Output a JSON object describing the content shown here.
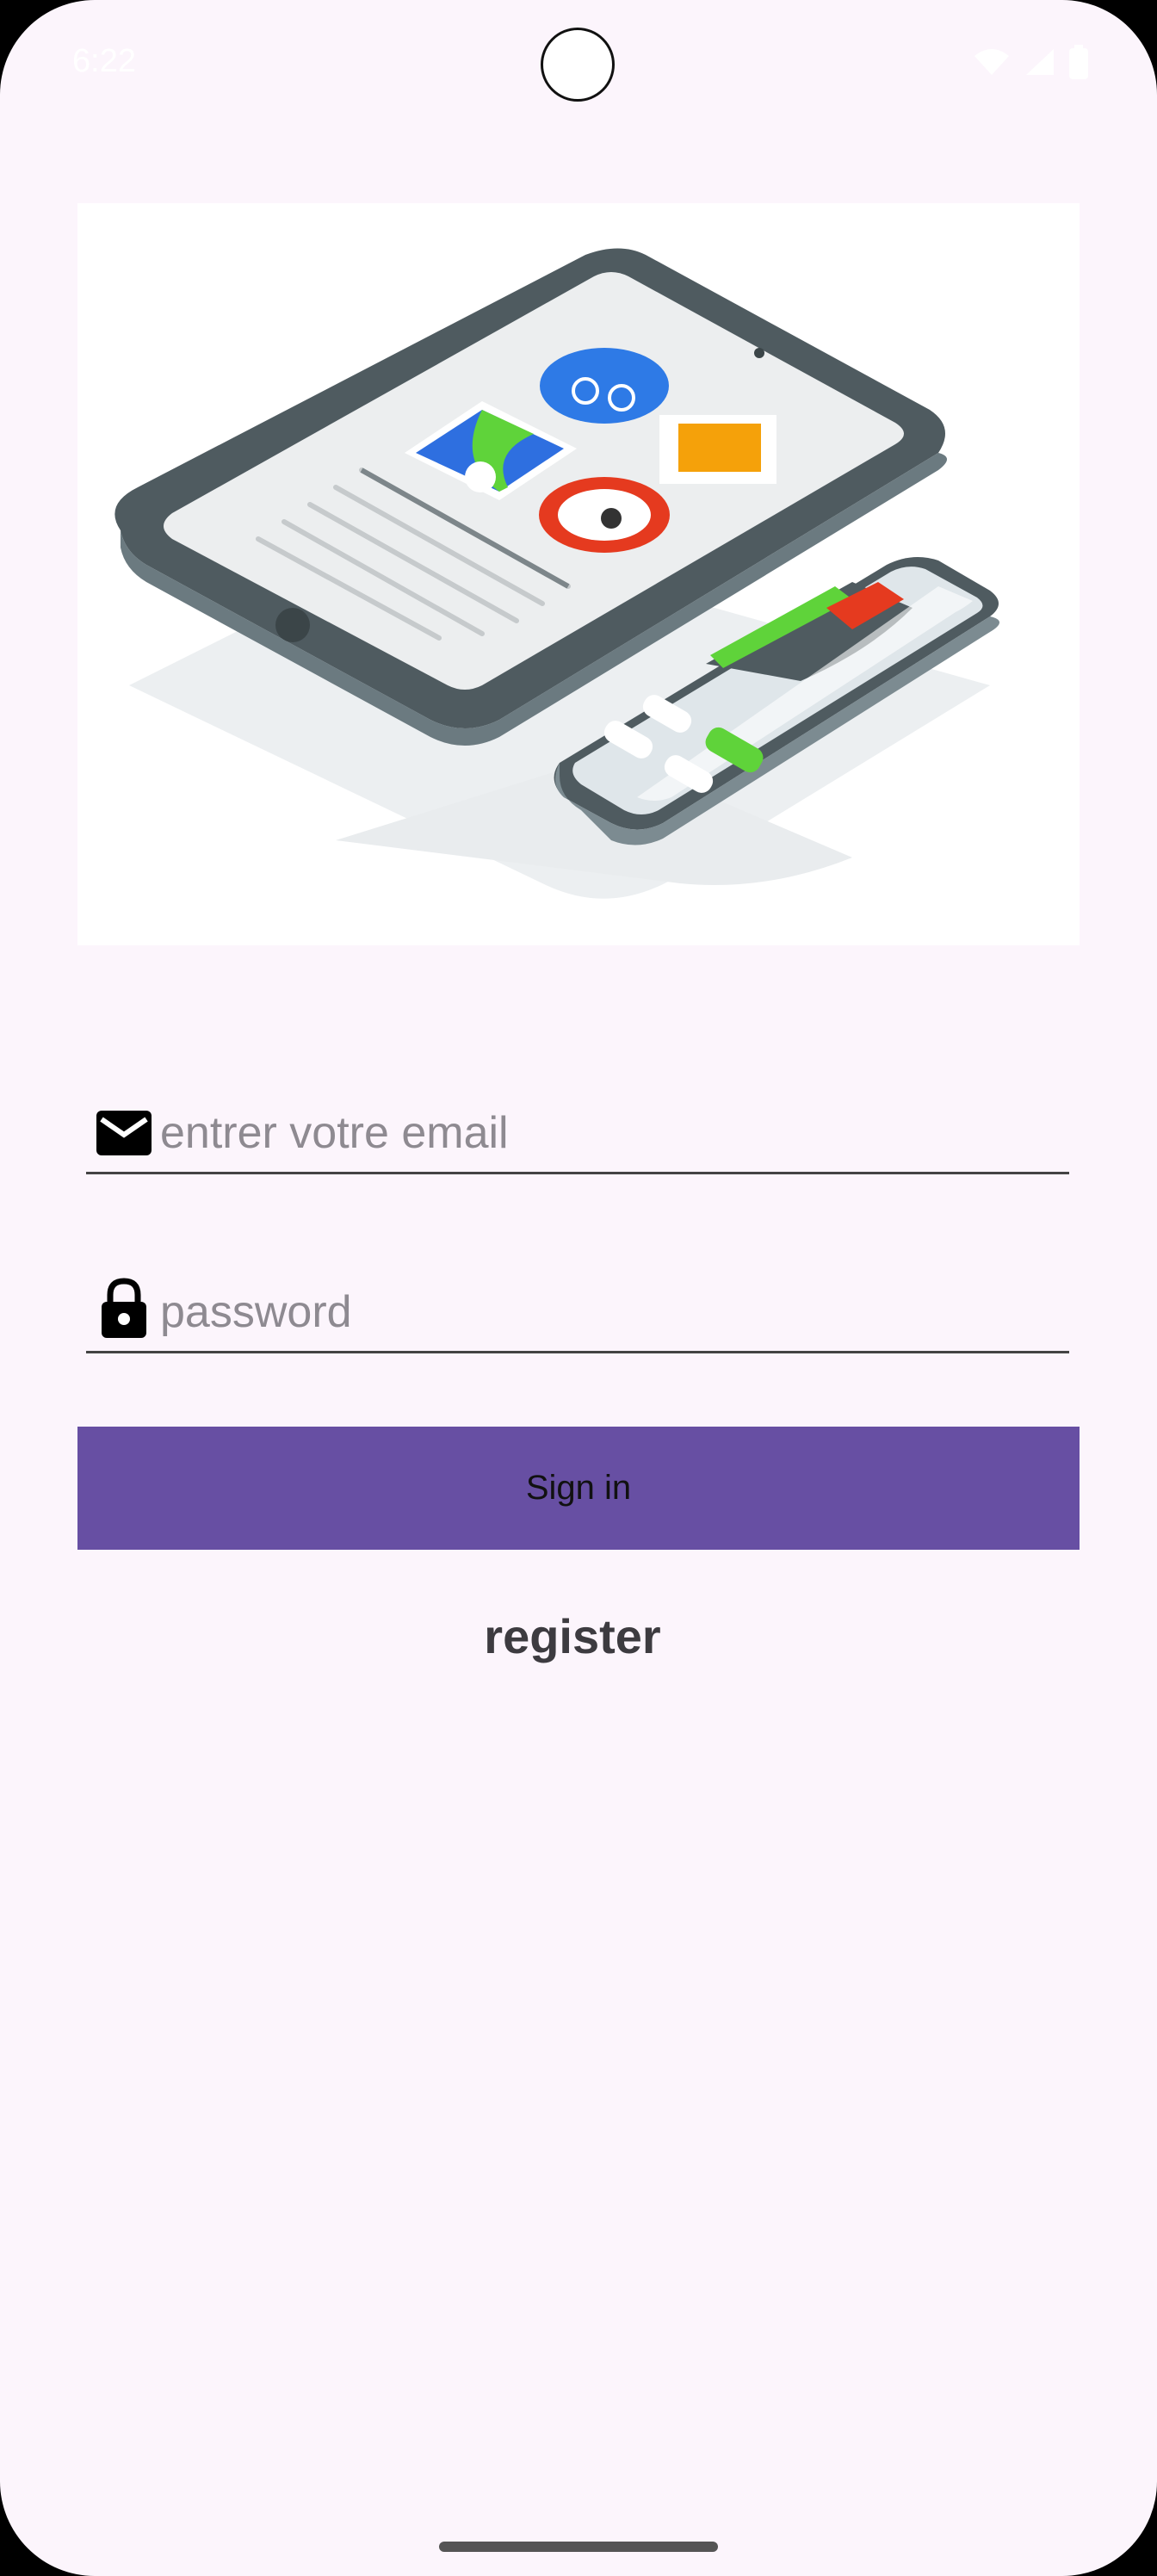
{
  "status_bar": {
    "time": "6:22"
  },
  "login": {
    "email_placeholder": "entrer votre email",
    "email_value": "",
    "password_placeholder": "password",
    "password_value": "",
    "signin_label": "Sign in",
    "register_label": "register"
  },
  "icons": {
    "email": "envelope-icon",
    "password": "lock-icon",
    "wifi": "wifi-icon",
    "signal": "signal-icon",
    "battery": "battery-icon"
  },
  "colors": {
    "background": "#fcf5fc",
    "button": "#674fa3",
    "register_text": "#3d3b40"
  }
}
